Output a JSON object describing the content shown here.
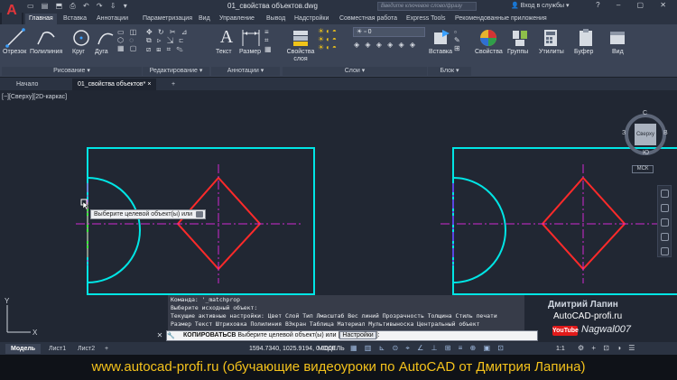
{
  "app": {
    "logo_letter": "A",
    "document_title": "01_свойства объектов.dwg",
    "search_placeholder": "Введите ключевое слово/фразу",
    "signin_label": "Вход в службы"
  },
  "ribbon_tabs": [
    "Главная",
    "Вставка",
    "Аннотации",
    "Параметризация",
    "Вид",
    "Управление",
    "Вывод",
    "Надстройки",
    "Совместная работа",
    "Express Tools",
    "Рекомендованные приложения"
  ],
  "ribbon": {
    "draw_tools": [
      "Отрезок",
      "Полилиния",
      "Круг",
      "Дуга"
    ],
    "annotation_tools": [
      "Текст",
      "Размер"
    ],
    "layer_props_label": "Свойства слоя",
    "layer_combo_value": "0",
    "block_tool": "Вставка",
    "right_tools": [
      "Свойства",
      "Группы",
      "Утилиты",
      "Буфер",
      "Вид"
    ],
    "groups": [
      "Рисование",
      "Редактирование",
      "Аннотации",
      "Слои",
      "Блок"
    ]
  },
  "file_tabs": [
    "Начало",
    "01_свойства объектов*"
  ],
  "viewport": {
    "label": "[−][Сверху][2D-каркас]",
    "viewcube": {
      "north": "С",
      "south": "Ю",
      "west": "З",
      "east": "В",
      "face": "Сверху",
      "ucs": "МСК"
    }
  },
  "tooltip": "Выберите целевой объект(ы) или",
  "command": {
    "history": [
      "Команда: '_matchprop",
      "Выберите исходный объект:",
      "Текущие активные настройки:  Цвет Слой Тип Лмасштаб Вес линий Прозрачность Толщина Стиль печати",
      "Размер Текст Штриховка Полилиния ВЭкран Таблица Материал Мультивыноска Центральный объект"
    ],
    "active_name": "КОПИРОВАТЬСВ",
    "active_prompt": "Выберите целевой объект(ы) или",
    "option": "Настройки",
    "suffix": "]:"
  },
  "watermark": {
    "name": "Дмитрий Лапин",
    "site": "AutoCAD-profi.ru",
    "youtube": "YouTube",
    "nickname": "Nagwal007"
  },
  "statusbar": {
    "layout_tabs": [
      "Модель",
      "Лист1",
      "Лист2"
    ],
    "coordinates": "1594.7340, 1025.9194, 0.0000",
    "mode": "МОДЕЛЬ",
    "scale": "1:1"
  },
  "banner": "www.autocad-profi.ru  (обучающие видеоуроки по AutoCAD от Дмитрия Лапина)",
  "colors": {
    "background": "#212733",
    "cyan": "#00e5e5",
    "red": "#ff2a2a",
    "magenta": "#d02ad0",
    "green": "#3cff3c",
    "banner_text": "#f4c21c"
  }
}
